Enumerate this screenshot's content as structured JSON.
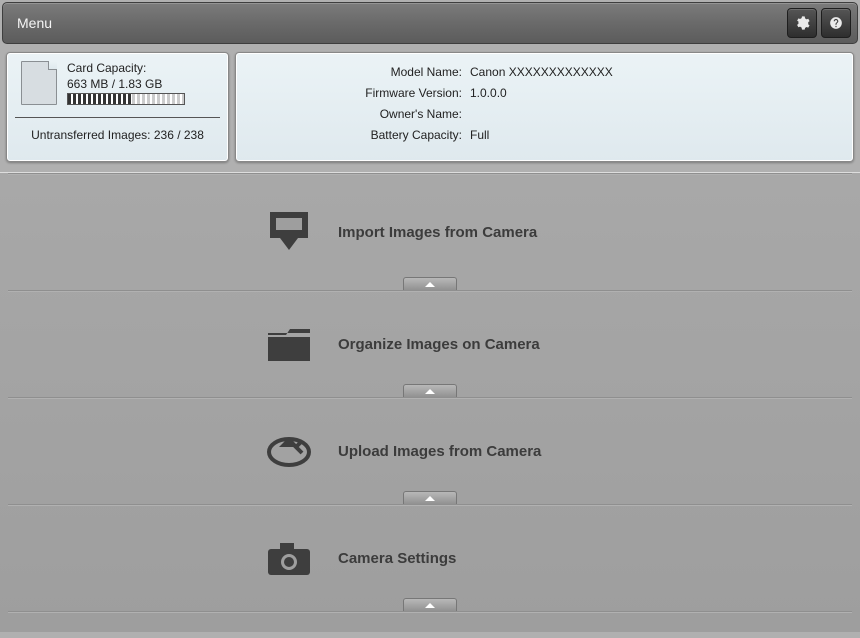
{
  "menubar": {
    "title": "Menu"
  },
  "card": {
    "capacity_label": "Card Capacity:",
    "capacity_value": "663 MB / 1.83 GB",
    "progress_percent": 55
  },
  "untransferred": {
    "label": "Untransferred Images:",
    "value": "236 / 238"
  },
  "camera_info": {
    "rows": [
      {
        "label": "Model Name:",
        "value": "Canon  XXXXXXXXXXXXX"
      },
      {
        "label": "Firmware Version:",
        "value": "1.0.0.0"
      },
      {
        "label": "Owner's Name:",
        "value": ""
      },
      {
        "label": "Battery Capacity:",
        "value": "Full"
      }
    ]
  },
  "sections": [
    {
      "label": "Import Images from Camera",
      "icon": "import"
    },
    {
      "label": "Organize Images on Camera",
      "icon": "organize"
    },
    {
      "label": "Upload Images from Camera",
      "icon": "upload"
    },
    {
      "label": "Camera Settings",
      "icon": "camera"
    }
  ]
}
